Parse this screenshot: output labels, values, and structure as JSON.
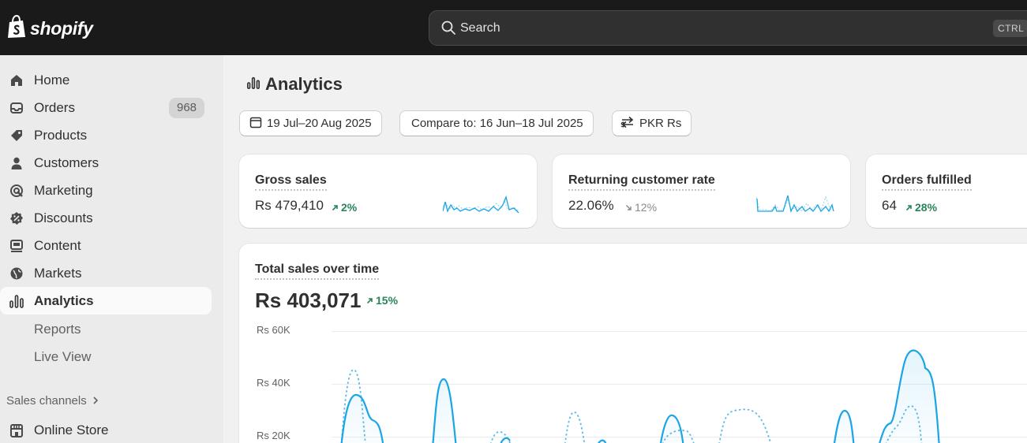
{
  "topbar": {
    "brand": "shopify",
    "search_placeholder": "Search",
    "search_shortcut": "CTRL"
  },
  "sidebar": {
    "items": [
      {
        "label": "Home",
        "icon": "home-icon"
      },
      {
        "label": "Orders",
        "icon": "inbox-icon",
        "badge": "968"
      },
      {
        "label": "Products",
        "icon": "tag-icon"
      },
      {
        "label": "Customers",
        "icon": "person-icon"
      },
      {
        "label": "Marketing",
        "icon": "target-icon"
      },
      {
        "label": "Discounts",
        "icon": "discount-icon"
      },
      {
        "label": "Content",
        "icon": "content-icon"
      },
      {
        "label": "Markets",
        "icon": "globe-icon"
      },
      {
        "label": "Analytics",
        "icon": "analytics-icon",
        "active": true
      }
    ],
    "subitems": [
      "Reports",
      "Live View"
    ],
    "sales_channels_title": "Sales channels",
    "channels": [
      {
        "label": "Online Store",
        "icon": "store-icon"
      }
    ]
  },
  "page": {
    "title": "Analytics",
    "filters": {
      "date_range": "19 Jul–20 Aug 2025",
      "compare": "Compare to: 16 Jun–18 Jul 2025",
      "currency": "PKR Rs"
    }
  },
  "metrics": [
    {
      "title": "Gross sales",
      "value": "Rs 479,410",
      "delta": "2%",
      "direction": "up"
    },
    {
      "title": "Returning customer rate",
      "value": "22.06%",
      "delta": "12%",
      "direction": "down"
    },
    {
      "title": "Orders fulfilled",
      "value": "64",
      "delta": "28%",
      "direction": "up"
    }
  ],
  "sales_chart": {
    "title": "Total sales over time",
    "total": "Rs 403,071",
    "delta": "15%",
    "y_ticks": [
      "Rs 60K",
      "Rs 40K",
      "Rs 20K"
    ]
  },
  "colors": {
    "accent_line": "#1aa6e4",
    "positive": "#29845a",
    "topbar": "#1a1a1a"
  }
}
